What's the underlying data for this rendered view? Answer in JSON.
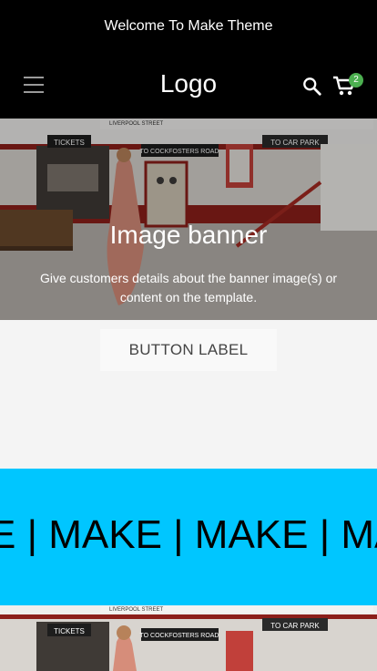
{
  "announcement": "Welcome To Make Theme",
  "header": {
    "logo": "Logo",
    "cart_count": "2"
  },
  "banner": {
    "title": "Image banner",
    "description": "Give customers details about the banner image(s) or content on the template."
  },
  "scene_signs": {
    "left": "TICKETS",
    "center": "TO COCKFOSTERS ROAD",
    "right": "TO CAR PARK",
    "top": "LIVERPOOL STREET"
  },
  "button": {
    "label": "BUTTON LABEL"
  },
  "marquee": {
    "text": "E | MAKE | MAKE | MAKE | M"
  },
  "colors": {
    "announcement_bg": "#000000",
    "marquee_bg": "#00c6ff",
    "badge": "#4caf50"
  }
}
